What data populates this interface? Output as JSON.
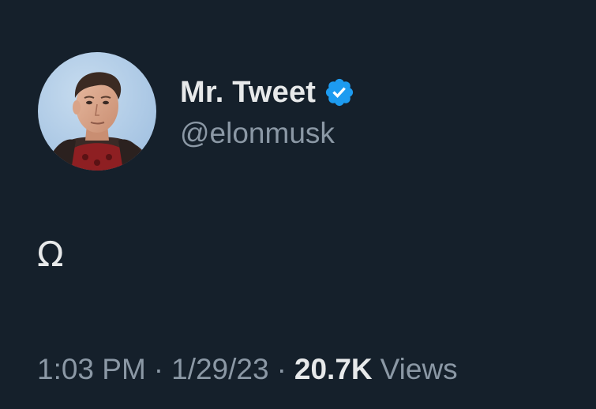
{
  "author": {
    "display_name": "Mr. Tweet",
    "handle": "@elonmusk",
    "verified": true,
    "verified_badge_icon": "verified-badge-icon",
    "verified_color": "#1d9bf0",
    "avatar_icon": "profile-avatar"
  },
  "tweet": {
    "text": "Ω"
  },
  "meta": {
    "time": "1:03 PM",
    "separator": "·",
    "date": "1/29/23",
    "views_count": "20.7K",
    "views_label": "Views"
  },
  "colors": {
    "background": "#15202b",
    "primary_text": "#e7e9ea",
    "secondary_text": "#8b98a5"
  }
}
